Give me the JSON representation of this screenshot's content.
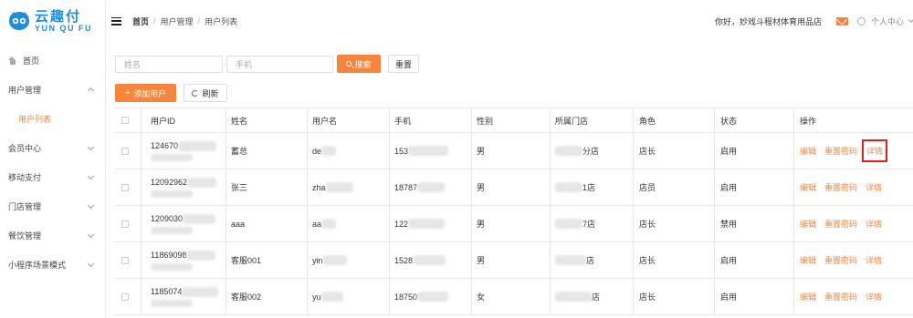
{
  "brand": {
    "name_cn": "云趣付",
    "name_en": "YUN QU FU",
    "color": "#1e8de0"
  },
  "accent_color": "#f7843a",
  "sidebar": {
    "items": [
      {
        "label": "首页",
        "icon": "home-icon"
      },
      {
        "label": "用户管理",
        "expanded": true
      },
      {
        "label": "用户列表",
        "active": true
      },
      {
        "label": "会员中心"
      },
      {
        "label": "移动支付"
      },
      {
        "label": "门店管理"
      },
      {
        "label": "餐饮管理"
      },
      {
        "label": "小程序场景模式"
      }
    ]
  },
  "header": {
    "breadcrumb": [
      "首页",
      "用户管理",
      "用户列表"
    ],
    "greeting": "你好，妙戏斗程材体育用品店",
    "user_menu": "个人中心"
  },
  "search": {
    "name_placeholder": "姓名",
    "phone_placeholder": "手机",
    "search_label": "搜索",
    "reset_label": "重置"
  },
  "actions": {
    "add_label": "添加用户",
    "refresh_label": "刷新"
  },
  "table": {
    "columns": [
      "用户ID",
      "姓名",
      "用户名",
      "手机",
      "性别",
      "所属门店",
      "角色",
      "状态",
      "操作"
    ],
    "operations": {
      "edit": "编辑",
      "reset_password": "重置密码",
      "detail": "详情"
    },
    "rows": [
      {
        "id": "124670",
        "name": "蓄总",
        "username": "de",
        "phone": "153",
        "gender": "男",
        "store": "分店",
        "role": "店长",
        "status": "启用"
      },
      {
        "id": "12092962",
        "name": "张三",
        "username": "zha",
        "phone": "18787",
        "gender": "男",
        "store": "1店",
        "role": "店员",
        "status": "启用"
      },
      {
        "id": "1209030",
        "name": "aaa",
        "username": "aa",
        "phone": "122",
        "gender": "男",
        "store": "7店",
        "role": "店长",
        "status": "禁用"
      },
      {
        "id": "11869098",
        "name": "客服001",
        "username": "yin",
        "phone": "1528",
        "gender": "男",
        "store": "店",
        "role": "店长",
        "status": "启用"
      },
      {
        "id": "1185074",
        "name": "客服002",
        "username": "yu",
        "phone": "18750",
        "gender": "女",
        "store": "店",
        "role": "店长",
        "status": "启用"
      }
    ]
  }
}
